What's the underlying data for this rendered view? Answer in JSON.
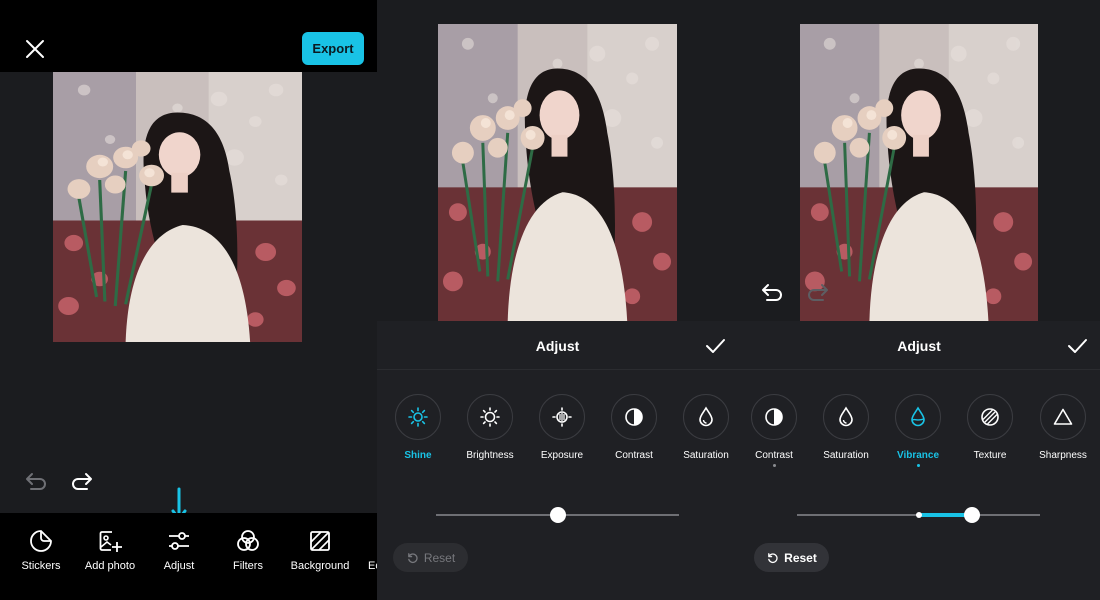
{
  "colors": {
    "accent": "#19c3e6",
    "bg": "#1b1c1f",
    "sheet": "#1f2024",
    "bar": "#000000"
  },
  "panel1": {
    "close_icon": "close-icon",
    "export_label": "Export",
    "tools": [
      {
        "label": "Stickers",
        "icon": "sticker-icon"
      },
      {
        "label": "Add photo",
        "icon": "add-photo-icon"
      },
      {
        "label": "Adjust",
        "icon": "sliders-icon"
      },
      {
        "label": "Filters",
        "icon": "filters-icon"
      },
      {
        "label": "Background",
        "icon": "background-icon"
      },
      {
        "label": "Ec",
        "icon": ""
      }
    ],
    "undo_enabled": false,
    "redo_enabled": true
  },
  "panel2": {
    "title": "Adjust",
    "options": [
      {
        "label": "Shine",
        "icon": "shine-icon",
        "active": true
      },
      {
        "label": "Brightness",
        "icon": "brightness-icon",
        "active": false
      },
      {
        "label": "Exposure",
        "icon": "exposure-icon",
        "active": false
      },
      {
        "label": "Contrast",
        "icon": "contrast-icon",
        "active": false
      },
      {
        "label": "Saturation",
        "icon": "saturation-icon",
        "active": false
      }
    ],
    "slider_value": 0.5,
    "reset_label": "Reset",
    "reset_enabled": false
  },
  "panel3": {
    "title": "Adjust",
    "options": [
      {
        "label": "Contrast",
        "icon": "contrast-icon",
        "active": false,
        "modified": true
      },
      {
        "label": "Saturation",
        "icon": "saturation-icon",
        "active": false,
        "modified": false
      },
      {
        "label": "Vibrance",
        "icon": "vibrance-icon",
        "active": true,
        "modified": true
      },
      {
        "label": "Texture",
        "icon": "texture-icon",
        "active": false,
        "modified": false
      },
      {
        "label": "Sharpness",
        "icon": "sharpness-icon",
        "active": false,
        "modified": false
      }
    ],
    "slider_value": 0.72,
    "reset_label": "Reset",
    "reset_enabled": true
  }
}
